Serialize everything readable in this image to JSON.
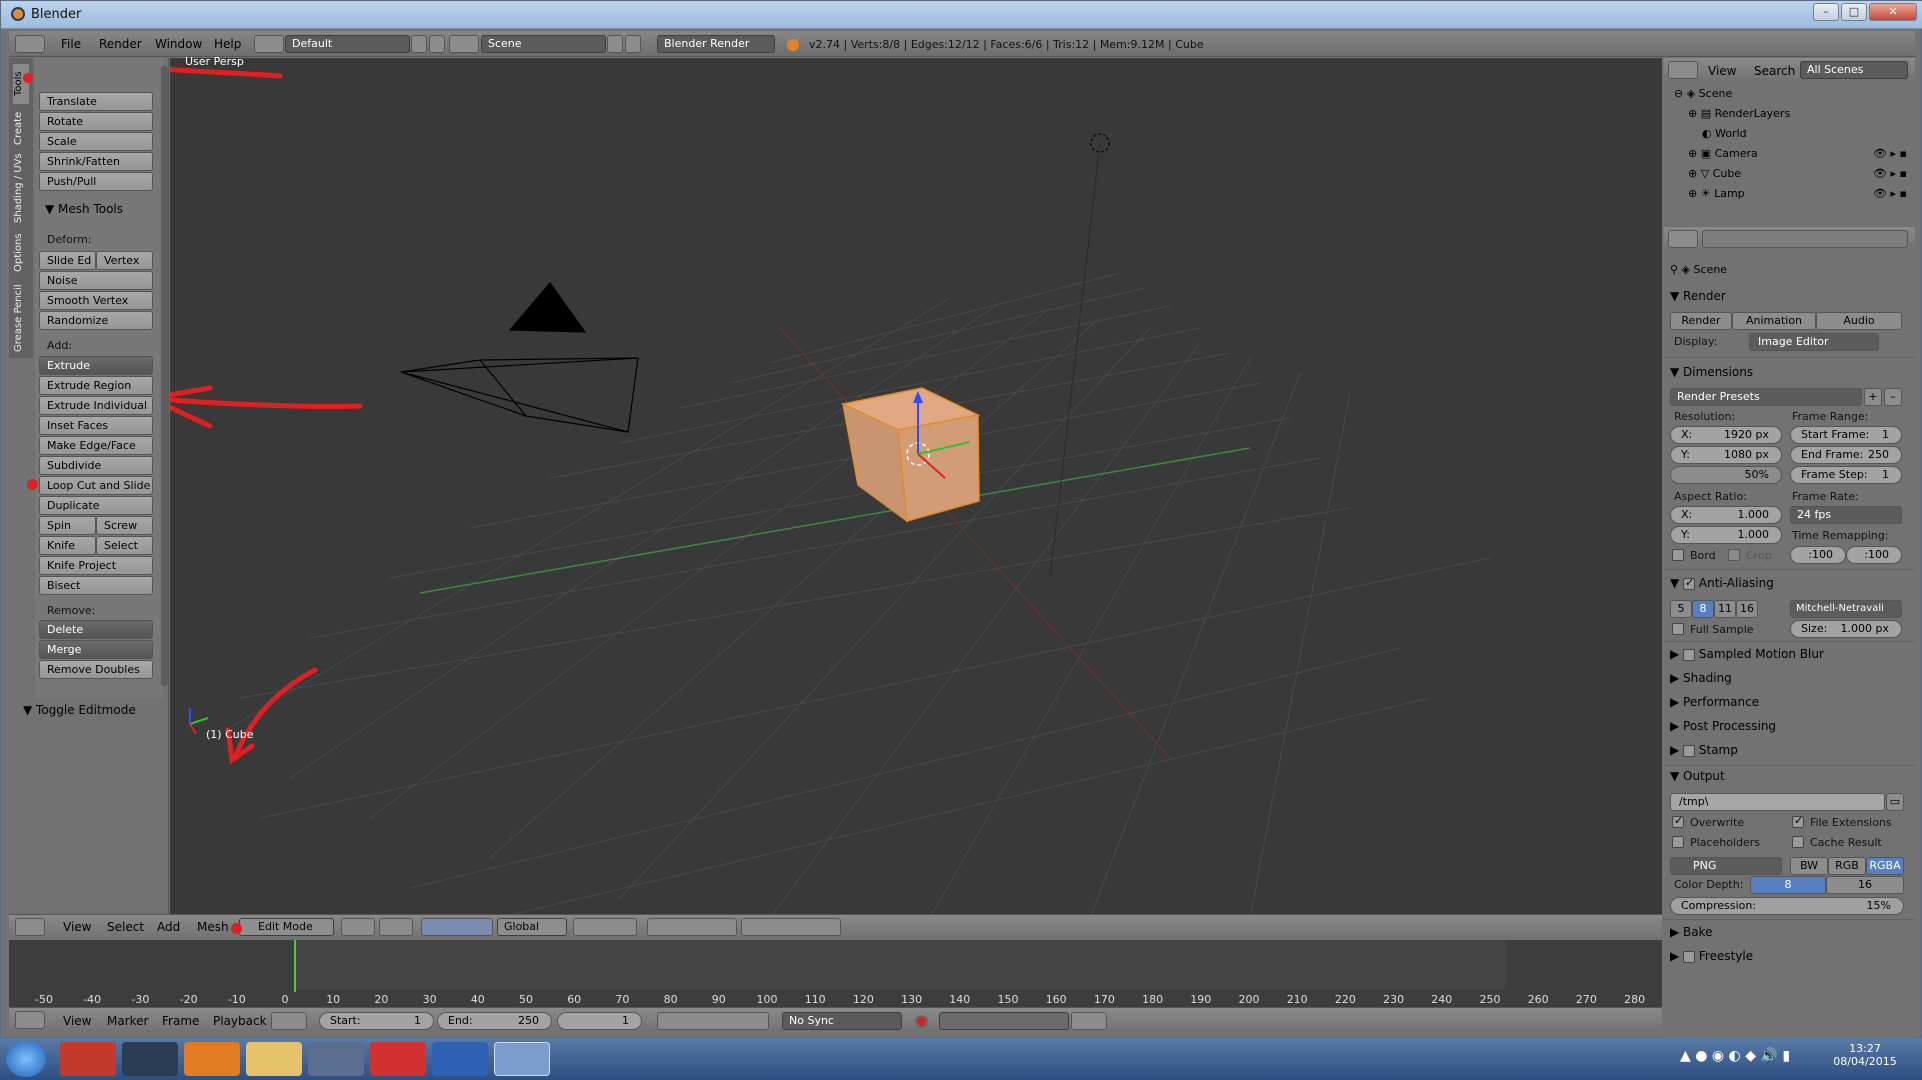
{
  "window": {
    "title": "Blender"
  },
  "info_header": {
    "menus": [
      "File",
      "Render",
      "Window",
      "Help"
    ],
    "layout": "Default",
    "scene": "Scene",
    "engine": "Blender Render",
    "stats": "v2.74 | Verts:8/8 | Edges:12/12 | Faces:6/6 | Tris:12 | Mem:9.12M | Cube"
  },
  "tool_shelf": {
    "tabs": [
      "Tools",
      "Create",
      "Shading / UVs",
      "Options",
      "Grease Pencil"
    ],
    "transform_buttons": [
      "Translate",
      "Rotate",
      "Scale",
      "Shrink/Fatten",
      "Push/Pull"
    ],
    "mesh_tools_title": "Mesh Tools",
    "deform_label": "Deform:",
    "deform": {
      "slide_edge": "Slide Ed",
      "vertex": "Vertex",
      "noise": "Noise",
      "smooth": "Smooth Vertex",
      "randomize": "Randomize"
    },
    "add_label": "Add:",
    "add": {
      "extrude": "Extrude",
      "extrude_region": "Extrude Region",
      "extrude_individual": "Extrude Individual",
      "inset": "Inset Faces",
      "make_edge": "Make Edge/Face",
      "subdivide": "Subdivide",
      "loop_cut": "Loop Cut and Slide",
      "duplicate": "Duplicate",
      "spin": "Spin",
      "screw": "Screw",
      "knife": "Knife",
      "select": "Select",
      "knife_project": "Knife Project",
      "bisect": "Bisect"
    },
    "remove_label": "Remove:",
    "remove": {
      "delete": "Delete",
      "merge": "Merge",
      "remove_doubles": "Remove Doubles"
    },
    "toggle_editmode": "Toggle Editmode"
  },
  "viewport": {
    "view_label": "User Persp",
    "object_label": "(1) Cube"
  },
  "viewport_header": {
    "menus": [
      "View",
      "Select",
      "Add",
      "Mesh"
    ],
    "mode": "Edit Mode",
    "orientation": "Global"
  },
  "timeline": {
    "ticks": [
      "-50",
      "-40",
      "-30",
      "-20",
      "-10",
      "0",
      "10",
      "20",
      "30",
      "40",
      "50",
      "60",
      "70",
      "80",
      "90",
      "100",
      "110",
      "120",
      "130",
      "140",
      "150",
      "160",
      "170",
      "180",
      "190",
      "200",
      "210",
      "220",
      "230",
      "240",
      "250",
      "260",
      "270",
      "280"
    ],
    "menus": [
      "View",
      "Marker",
      "Frame",
      "Playback"
    ],
    "start_label": "Start:",
    "start": "1",
    "end_label": "End:",
    "end": "250",
    "current": "1",
    "sync": "No Sync"
  },
  "outliner": {
    "menus": [
      "View",
      "Search"
    ],
    "filter": "All Scenes",
    "items": [
      "Scene",
      "RenderLayers",
      "World",
      "Camera",
      "Cube",
      "Lamp"
    ]
  },
  "properties": {
    "context": "Scene",
    "render_title": "Render",
    "render_buttons": [
      "Render",
      "Animation",
      "Audio"
    ],
    "display_label": "Display:",
    "display": "Image Editor",
    "dimensions_title": "Dimensions",
    "presets": "Render Presets",
    "resolution_label": "Resolution:",
    "res_x_label": "X:",
    "res_x": "1920 px",
    "res_y_label": "Y:",
    "res_y": "1080 px",
    "res_pct": "50%",
    "frame_range_label": "Frame Range:",
    "start_frame_label": "Start Frame:",
    "start_frame": "1",
    "end_frame_label": "End Frame:",
    "end_frame": "250",
    "frame_step_label": "Frame Step:",
    "frame_step": "1",
    "aspect_label": "Aspect Ratio:",
    "aspect_x_label": "X:",
    "aspect_x": "1.000",
    "aspect_y_label": "Y:",
    "aspect_y": "1.000",
    "frame_rate_label": "Frame Rate:",
    "frame_rate": "24 fps",
    "time_remap_label": "Time Remapping:",
    "remap_old": ":100",
    "remap_new": ":100",
    "border": "Bord",
    "crop": "Crop",
    "aa_title": "Anti-Aliasing",
    "aa_samples": [
      "5",
      "8",
      "11",
      "16"
    ],
    "aa_filter": "Mitchell-Netravali",
    "full_sample": "Full Sample",
    "size_label": "Size:",
    "size": "1.000 px",
    "sections": [
      "Sampled Motion Blur",
      "Shading",
      "Performance",
      "Post Processing",
      "Stamp"
    ],
    "output_title": "Output",
    "output_path": "/tmp\\",
    "overwrite": "Overwrite",
    "file_ext": "File Extensions",
    "placeholders": "Placeholders",
    "cache": "Cache Result",
    "format": "PNG",
    "color_modes": [
      "BW",
      "RGB",
      "RGBA"
    ],
    "color_depth_label": "Color Depth:",
    "depths": [
      "8",
      "16"
    ],
    "compression_label": "Compression:",
    "compression": "15%",
    "bake": "Bake",
    "freestyle": "Freestyle"
  },
  "taskbar": {
    "time": "13:27",
    "date": "08/04/2015"
  },
  "colors": {
    "accent_blue": "#5680c2",
    "selection_orange": "#e8a05a",
    "annotation_red": "#e02020"
  }
}
